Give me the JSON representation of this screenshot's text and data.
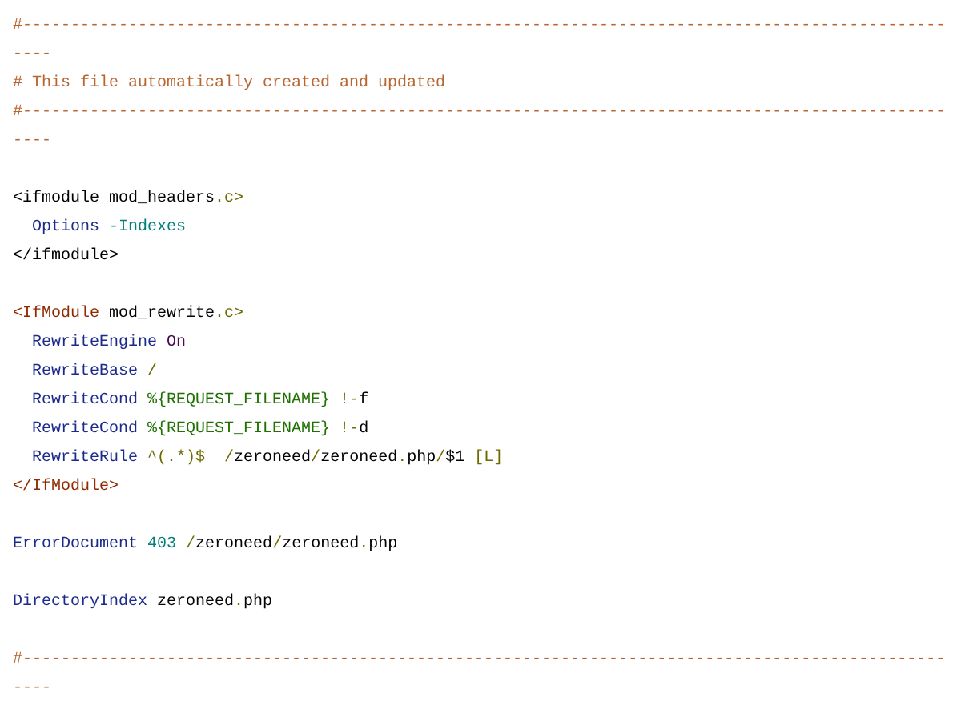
{
  "blocks": [
    {
      "lines": [
        {
          "indented": false,
          "tokens": [
            {
              "kind": "comment",
              "text": "#----------------------------------------------------------------------------------------------------"
            }
          ]
        },
        {
          "indented": false,
          "tokens": [
            {
              "kind": "comment",
              "text": "# This file automatically created and updated"
            }
          ]
        },
        {
          "indented": false,
          "tokens": [
            {
              "kind": "comment",
              "text": "#----------------------------------------------------------------------------------------------------"
            }
          ]
        }
      ]
    },
    {
      "lines": [
        {
          "indented": false,
          "tokens": [
            {
              "kind": "plain",
              "text": "<ifmodule mod_headers"
            },
            {
              "kind": "punct",
              "text": ".c>"
            }
          ]
        },
        {
          "indented": true,
          "tokens": [
            {
              "kind": "directive",
              "text": "Options "
            },
            {
              "kind": "teal",
              "text": "-Indexes"
            }
          ]
        },
        {
          "indented": false,
          "tokens": [
            {
              "kind": "plain",
              "text": "</ifmodule>"
            }
          ]
        }
      ]
    },
    {
      "lines": [
        {
          "indented": false,
          "tokens": [
            {
              "kind": "tag",
              "text": "<IfModule"
            },
            {
              "kind": "plain",
              "text": " mod_rewrite"
            },
            {
              "kind": "punct",
              "text": ".c>"
            }
          ]
        },
        {
          "indented": true,
          "tokens": [
            {
              "kind": "directive",
              "text": "RewriteEngine "
            },
            {
              "kind": "keyword",
              "text": "On"
            }
          ]
        },
        {
          "indented": true,
          "tokens": [
            {
              "kind": "directive",
              "text": "RewriteBase "
            },
            {
              "kind": "punct",
              "text": "/"
            }
          ]
        },
        {
          "indented": true,
          "tokens": [
            {
              "kind": "directive",
              "text": "RewriteCond "
            },
            {
              "kind": "variable",
              "text": "%{REQUEST_FILENAME}"
            },
            {
              "kind": "punct",
              "text": " !-"
            },
            {
              "kind": "plain",
              "text": "f"
            }
          ]
        },
        {
          "indented": true,
          "tokens": [
            {
              "kind": "directive",
              "text": "RewriteCond "
            },
            {
              "kind": "variable",
              "text": "%{REQUEST_FILENAME}"
            },
            {
              "kind": "punct",
              "text": " !-"
            },
            {
              "kind": "plain",
              "text": "d"
            }
          ]
        },
        {
          "indented": true,
          "tokens": [
            {
              "kind": "directive",
              "text": "RewriteRule "
            },
            {
              "kind": "punct",
              "text": "^(.*)$  /"
            },
            {
              "kind": "plain",
              "text": "zeroneed"
            },
            {
              "kind": "punct",
              "text": "/"
            },
            {
              "kind": "plain",
              "text": "zeroneed"
            },
            {
              "kind": "punct",
              "text": "."
            },
            {
              "kind": "plain",
              "text": "php"
            },
            {
              "kind": "punct",
              "text": "/"
            },
            {
              "kind": "plain",
              "text": "$1 "
            },
            {
              "kind": "punct",
              "text": "[L]"
            }
          ]
        },
        {
          "indented": false,
          "tokens": [
            {
              "kind": "tag",
              "text": "</IfModule>"
            }
          ]
        }
      ]
    },
    {
      "lines": [
        {
          "indented": false,
          "tokens": [
            {
              "kind": "directive",
              "text": "ErrorDocument "
            },
            {
              "kind": "teal",
              "text": "403 "
            },
            {
              "kind": "punct",
              "text": "/"
            },
            {
              "kind": "plain",
              "text": "zeroneed"
            },
            {
              "kind": "punct",
              "text": "/"
            },
            {
              "kind": "plain",
              "text": "zeroneed"
            },
            {
              "kind": "punct",
              "text": "."
            },
            {
              "kind": "plain",
              "text": "php"
            }
          ]
        }
      ]
    },
    {
      "lines": [
        {
          "indented": false,
          "tokens": [
            {
              "kind": "directive",
              "text": "DirectoryIndex "
            },
            {
              "kind": "plain",
              "text": "zeroneed"
            },
            {
              "kind": "punct",
              "text": "."
            },
            {
              "kind": "plain",
              "text": "php"
            }
          ]
        }
      ]
    },
    {
      "lines": [
        {
          "indented": false,
          "tokens": [
            {
              "kind": "comment",
              "text": "#----------------------------------------------------------------------------------------------------"
            }
          ]
        }
      ]
    }
  ]
}
